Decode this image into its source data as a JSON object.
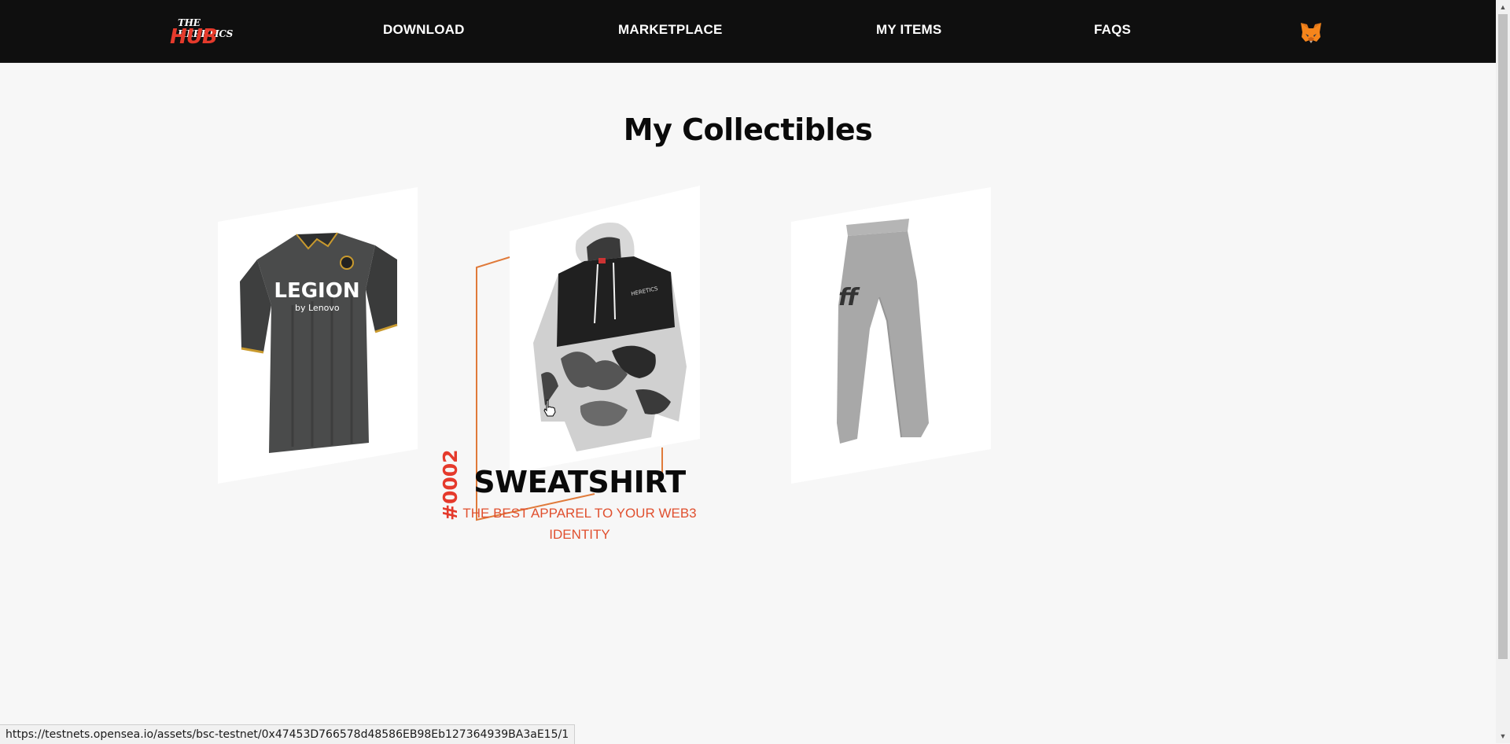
{
  "nav": {
    "logo_small": "THE HERETICS",
    "logo_big": "HUB",
    "links": [
      "DOWNLOAD",
      "MARKETPLACE",
      "MY ITEMS",
      "FAQS"
    ],
    "wallet_icon": "metamask-fox-icon"
  },
  "page": {
    "heading": "My Collectibles"
  },
  "collectibles": [
    {
      "image": "jersey-image"
    },
    {
      "image": "sweatshirt-image",
      "id": "#0002",
      "title": "SWEATSHIRT",
      "description": "THE BEST APPAREL TO YOUR WEB3 IDENTITY"
    },
    {
      "image": "pants-image"
    }
  ],
  "status_url": "https://testnets.opensea.io/assets/bsc-testnet/0x47453D766578d48586EB98Eb127364939BA3aE15/1",
  "colors": {
    "nav_bg": "#0f0f0f",
    "accent": "#e53a2c",
    "frame_line": "#e07a3a",
    "page_bg": "#f7f7f7"
  }
}
